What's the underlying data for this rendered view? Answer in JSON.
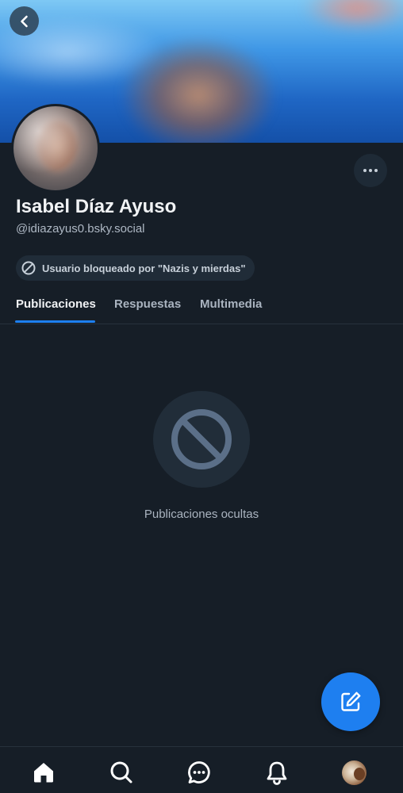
{
  "profile": {
    "name": "Isabel Díaz Ayuso",
    "handle": "@idiazayus0.bsky.social",
    "blocked_label": "Usuario bloqueado por \"Nazis y mierdas\""
  },
  "tabs": [
    {
      "label": "Publicaciones",
      "active": true
    },
    {
      "label": "Respuestas",
      "active": false
    },
    {
      "label": "Multimedia",
      "active": false
    }
  ],
  "empty_state": {
    "text": "Publicaciones ocultas",
    "icon": "block-icon"
  },
  "icons": {
    "back": "chevron-left-icon",
    "more": "more-horizontal-icon",
    "compose": "compose-icon",
    "nav": [
      "home-icon",
      "search-icon",
      "chat-icon",
      "bell-icon",
      "profile-avatar"
    ]
  },
  "colors": {
    "background": "#161e27",
    "accent": "#1e7ff0",
    "text_primary": "#f1f3f5",
    "text_secondary": "#aab4c0",
    "surface": "#202c38"
  }
}
